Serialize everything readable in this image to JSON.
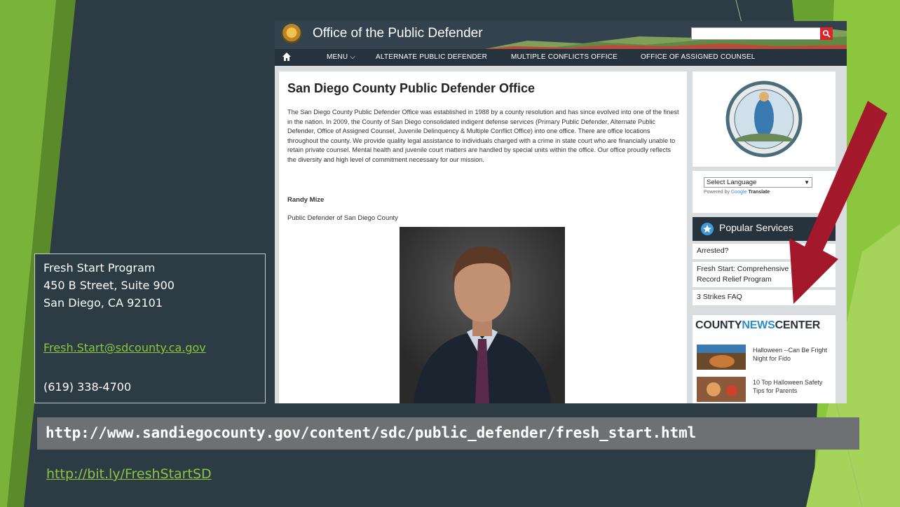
{
  "site": {
    "title": "Office of the Public Defender",
    "search_placeholder": "",
    "nav": [
      {
        "label": "MENU"
      },
      {
        "label": "ALTERNATE PUBLIC DEFENDER"
      },
      {
        "label": "MULTIPLE CONFLICTS OFFICE"
      },
      {
        "label": "OFFICE OF ASSIGNED COUNSEL"
      }
    ],
    "main": {
      "heading": "San Diego County Public Defender Office",
      "body": "The San Diego County Public Defender Office was established in 1988 by a county resolution and has since evolved into one of the finest in the nation.  In 2009, the County of San Diego consolidated indigent defense services (Primary Public Defender, Alternate Public Defender, Office of Assigned Counsel, Juvenile Delinquency & Multiple Conflict Office) into one office. There are office locations throughout the county. We provide quality legal assistance to individuals charged with a crime in state court who are financially unable to retain private counsel. Mental health and juvenile court matters are handled by special units within the office. Our office proudly reflects the diversity and high level of commitment necessary for our mission.",
      "signer_name": "Randy Mize",
      "signer_title": "Public Defender of San Diego County"
    },
    "sidebar": {
      "language_select": "Select Language",
      "powered_by": "Powered by",
      "google": "Google",
      "translate": "Translate",
      "popular_title": "Popular Services",
      "services": [
        {
          "label": "Arrested?"
        },
        {
          "label": "Fresh Start: Comprehensive Criminal Record Relief Program"
        },
        {
          "label": "3 Strikes FAQ"
        }
      ],
      "news_brand_a": "COUNTY",
      "news_brand_b": "NEWS",
      "news_brand_c": "CENTER",
      "news": [
        {
          "label": "Halloween --Can Be Fright Night for Fido"
        },
        {
          "label": "10 Top Halloween Safety Tips for Parents"
        }
      ]
    }
  },
  "contact": {
    "program": "Fresh Start Program",
    "street": "450 B Street, Suite 900",
    "city": "San Diego, CA 92101",
    "email": "Fresh.Start@sdcounty.ca.gov",
    "phone": "(619) 338-4700"
  },
  "url_long": "http://www.sandiegocounty.gov/content/sdc/public_defender/fresh_start.html",
  "url_short": "http://bit.ly/FreshStartSD",
  "colors": {
    "accent_green": "#8cc63f",
    "arrow_red": "#a3182a",
    "slide_bg": "#2d3b45"
  }
}
